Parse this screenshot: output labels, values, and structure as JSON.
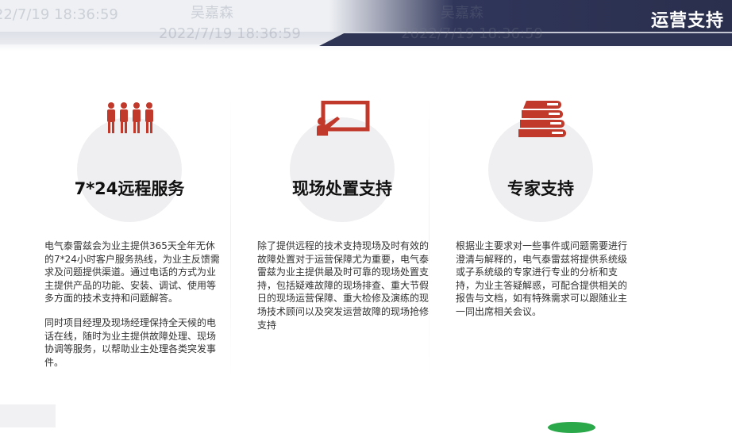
{
  "header": {
    "title": "运营支持"
  },
  "watermarks": [
    {
      "text": "吴嘉森"
    },
    {
      "text": "2022/7/19 18:36:59"
    }
  ],
  "columns": [
    {
      "icon": "people-icon",
      "heading": "7*24远程服务",
      "paragraphs": [
        "电气泰雷兹会为业主提供365天全年无休的7*24小时客户服务热线，为业主反馈需求及问题提供渠道。通过电话的方式为业主提供产品的功能、安装、调试、使用等多方面的技术支持和问题解答。",
        "同时项目经理及现场经理保持全天候的电话在线，随时为业主提供故障处理、现场协调等服务，以帮助业主处理各类突发事件。"
      ]
    },
    {
      "icon": "presenter-board-icon",
      "heading": "现场处置支持",
      "paragraphs": [
        "除了提供远程的技术支持现场及时有效的故障处置对于运营保障尤为重要，电气泰雷兹为业主提供最及时可靠的现场处置支持，包括疑难故障的现场排查、重大节假日的现场运营保障、重大检修及演练的现场技术顾问以及突发运营故障的现场抢修支持"
      ]
    },
    {
      "icon": "books-icon",
      "heading": "专家支持",
      "paragraphs": [
        "根据业主要求对一些事件或问题需要进行澄清与解释的，电气泰雷兹将提供系统级或子系统级的专家进行专业的分析和支持，为业主答疑解惑，可配合提供相关的报告与文档，如有特殊需求可以跟随业主一同出席相关会议。"
      ]
    }
  ],
  "colors": {
    "icon_red": "#c0392b",
    "banner_dark": "#2e3454",
    "circle_bg": "#efeff1"
  }
}
